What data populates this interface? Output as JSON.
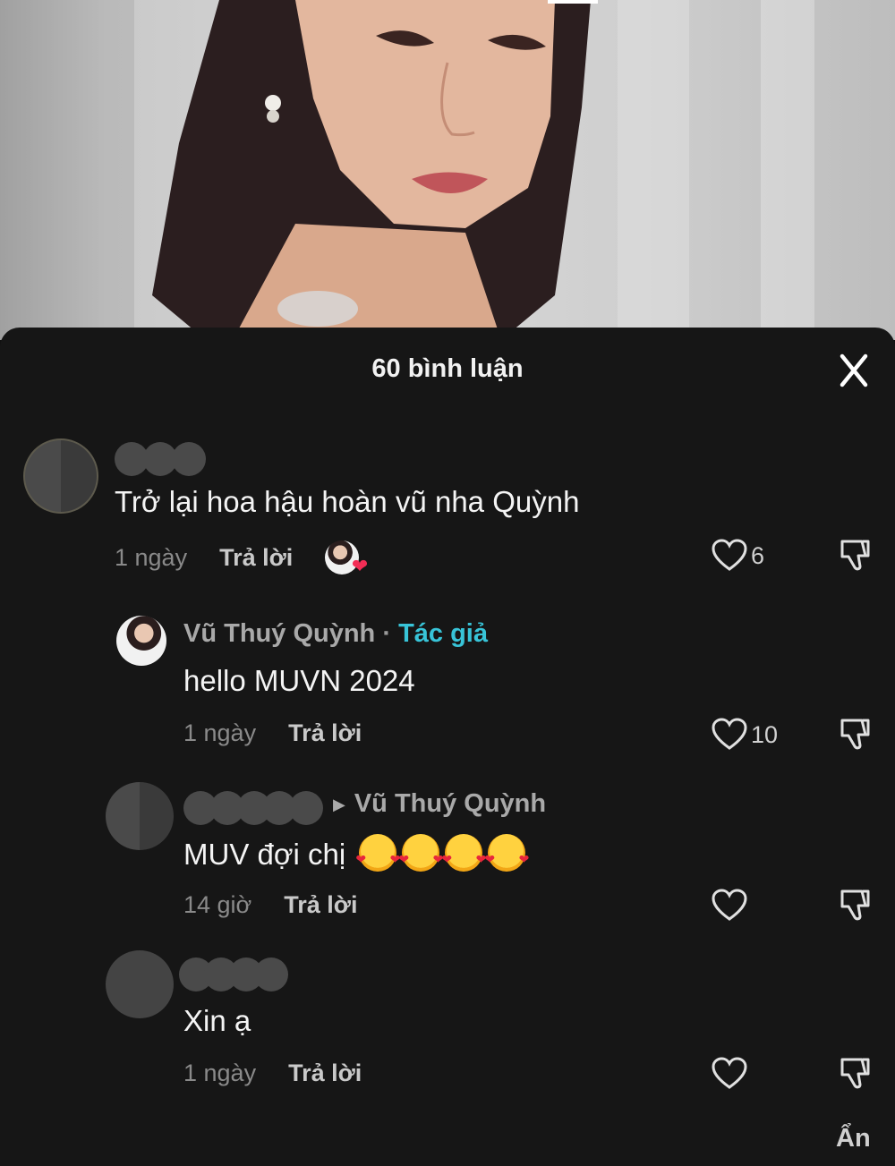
{
  "comments_panel": {
    "title": "60 bình luận",
    "close_icon": "close-icon",
    "hide_label": "Ẩn"
  },
  "comments": [
    {
      "text": "Trở lại hoa hậu hoàn vũ nha Quỳnh",
      "time": "1 ngày",
      "reply_label": "Trả lời",
      "likes": "6",
      "liked_by_author": true
    },
    {
      "author": "Vũ Thuý Quỳnh",
      "author_badge": "Tác giả",
      "text": "hello MUVN 2024",
      "time": "1 ngày",
      "reply_label": "Trả lời",
      "likes": "10"
    },
    {
      "reply_to": "Vũ Thuý Quỳnh",
      "text": "MUV đợi chị",
      "emoji": "smiling-face-with-hearts",
      "emoji_count": 4,
      "time": "14 giờ",
      "reply_label": "Trả lời",
      "likes": ""
    },
    {
      "text": "Xin ạ",
      "time": "1 ngày",
      "reply_label": "Trả lời",
      "likes": ""
    }
  ],
  "colors": {
    "sheet_background": "#161616",
    "author_badge": "#38c4d8",
    "liked_heart": "#f22d55"
  }
}
